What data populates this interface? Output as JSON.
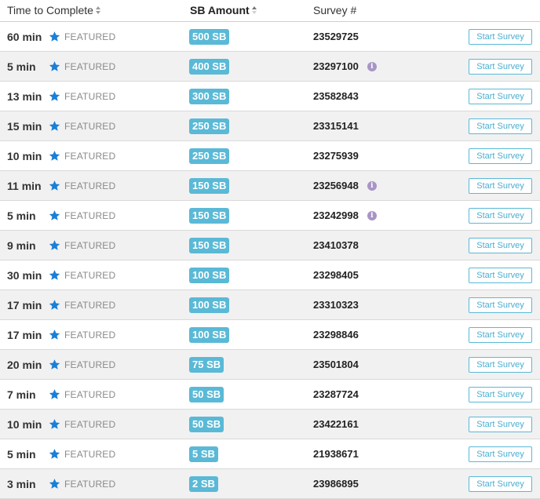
{
  "header": {
    "time_label": "Time to Complete",
    "amount_label": "SB Amount",
    "survey_label": "Survey #"
  },
  "icons": {
    "featured": "star-icon",
    "info": "info-icon",
    "sort": "sort-icon"
  },
  "colors": {
    "badge": "#5ab9d6",
    "star": "#1a7fd6",
    "info": "#a895c6",
    "button_border": "#5ab9d6"
  },
  "rows": [
    {
      "time": "60 min",
      "featured": "FEATURED",
      "amount": "500 SB",
      "survey": "23529725",
      "info": false,
      "action": "Start Survey"
    },
    {
      "time": "5 min",
      "featured": "FEATURED",
      "amount": "400 SB",
      "survey": "23297100",
      "info": true,
      "action": "Start Survey"
    },
    {
      "time": "13 min",
      "featured": "FEATURED",
      "amount": "300 SB",
      "survey": "23582843",
      "info": false,
      "action": "Start Survey"
    },
    {
      "time": "15 min",
      "featured": "FEATURED",
      "amount": "250 SB",
      "survey": "23315141",
      "info": false,
      "action": "Start Survey"
    },
    {
      "time": "10 min",
      "featured": "FEATURED",
      "amount": "250 SB",
      "survey": "23275939",
      "info": false,
      "action": "Start Survey"
    },
    {
      "time": "11 min",
      "featured": "FEATURED",
      "amount": "150 SB",
      "survey": "23256948",
      "info": true,
      "action": "Start Survey"
    },
    {
      "time": "5 min",
      "featured": "FEATURED",
      "amount": "150 SB",
      "survey": "23242998",
      "info": true,
      "action": "Start Survey"
    },
    {
      "time": "9 min",
      "featured": "FEATURED",
      "amount": "150 SB",
      "survey": "23410378",
      "info": false,
      "action": "Start Survey"
    },
    {
      "time": "30 min",
      "featured": "FEATURED",
      "amount": "100 SB",
      "survey": "23298405",
      "info": false,
      "action": "Start Survey"
    },
    {
      "time": "17 min",
      "featured": "FEATURED",
      "amount": "100 SB",
      "survey": "23310323",
      "info": false,
      "action": "Start Survey"
    },
    {
      "time": "17 min",
      "featured": "FEATURED",
      "amount": "100 SB",
      "survey": "23298846",
      "info": false,
      "action": "Start Survey"
    },
    {
      "time": "20 min",
      "featured": "FEATURED",
      "amount": "75 SB",
      "survey": "23501804",
      "info": false,
      "action": "Start Survey"
    },
    {
      "time": "7 min",
      "featured": "FEATURED",
      "amount": "50 SB",
      "survey": "23287724",
      "info": false,
      "action": "Start Survey"
    },
    {
      "time": "10 min",
      "featured": "FEATURED",
      "amount": "50 SB",
      "survey": "23422161",
      "info": false,
      "action": "Start Survey"
    },
    {
      "time": "5 min",
      "featured": "FEATURED",
      "amount": "5 SB",
      "survey": "21938671",
      "info": false,
      "action": "Start Survey"
    },
    {
      "time": "3 min",
      "featured": "FEATURED",
      "amount": "2 SB",
      "survey": "23986895",
      "info": false,
      "action": "Start Survey"
    }
  ]
}
